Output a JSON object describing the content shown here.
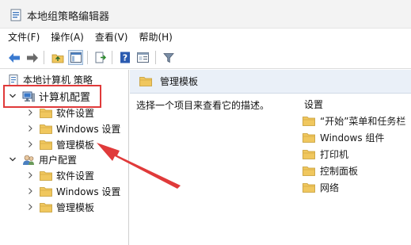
{
  "window": {
    "title": "本地组策略编辑器"
  },
  "menu": [
    "文件(F)",
    "操作(A)",
    "查看(V)",
    "帮助(H)"
  ],
  "toolbar": {
    "buttons": [
      "back-icon",
      "forward-icon",
      "up-folder-icon",
      "show-hide-tree-icon",
      "export-list-icon",
      "help-icon",
      "properties-icon",
      "filter-icon"
    ]
  },
  "tree": {
    "root": "本地计算机 策略",
    "computer_config": "计算机配置",
    "computer_children": [
      "软件设置",
      "Windows 设置",
      "管理模板"
    ],
    "user_config": "用户配置",
    "user_children": [
      "软件设置",
      "Windows 设置",
      "管理模板"
    ]
  },
  "right_pane": {
    "header": "管理模板",
    "description": "选择一个项目来查看它的描述。",
    "column_header": "设置",
    "items": [
      "“开始”菜单和任务栏",
      "Windows 组件",
      "打印机",
      "控制面板",
      "网络"
    ]
  },
  "colors": {
    "annotation": "#e03a3a",
    "folder": "#f0c75e"
  }
}
